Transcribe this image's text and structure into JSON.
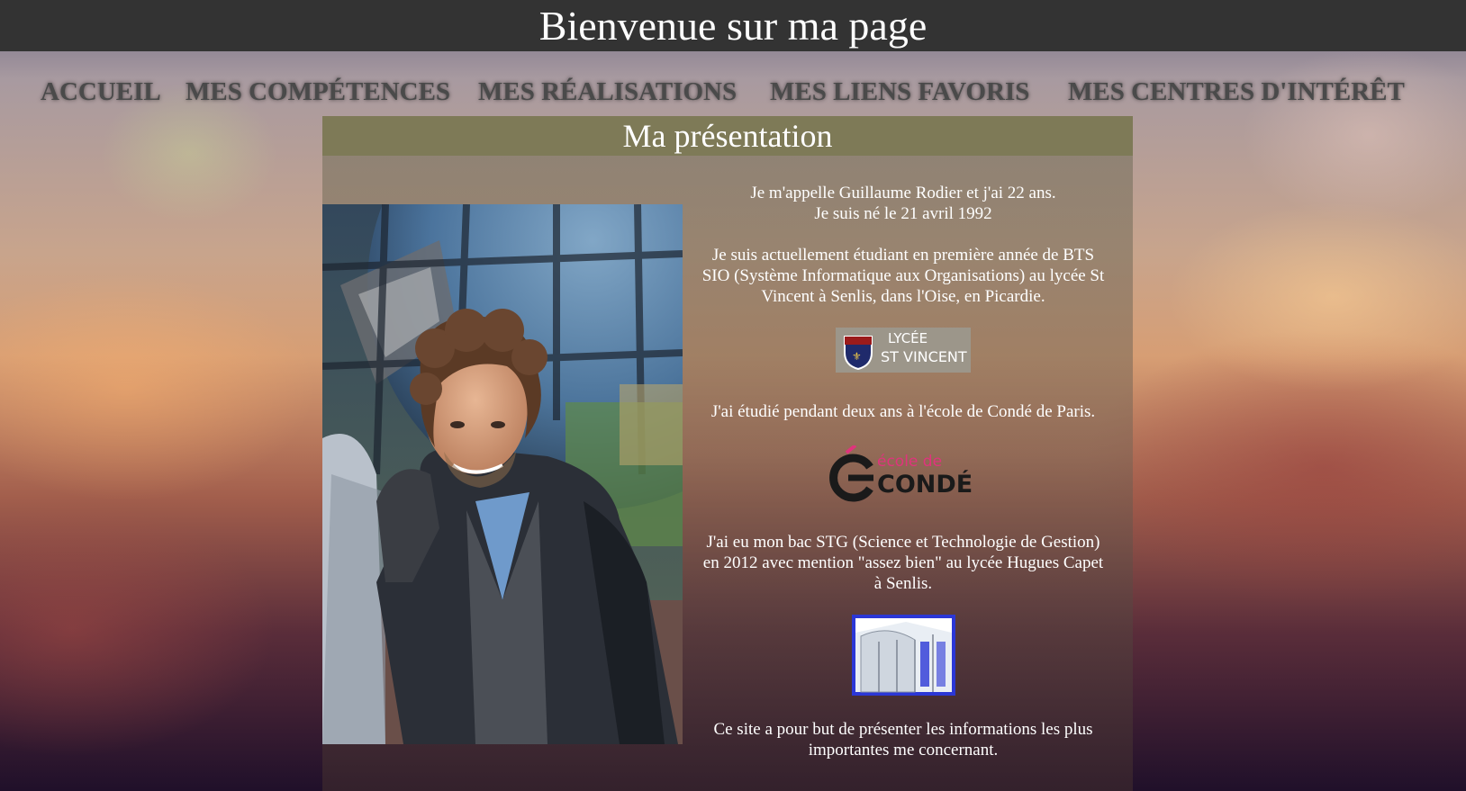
{
  "header": {
    "title": "Bienvenue sur ma page"
  },
  "nav": {
    "items": [
      {
        "label": "ACCUEIL"
      },
      {
        "label": "MES COMPÉTENCES"
      },
      {
        "label": "MES RÉALISATIONS"
      },
      {
        "label": "MES LIENS FAVORIS"
      },
      {
        "label": "MES CENTRES D'INTÉRÊT"
      }
    ]
  },
  "main": {
    "title": "Ma présentation",
    "intro_line1": "Je m'appelle Guillaume Rodier et j'ai 22 ans.",
    "intro_line2": "Je suis né le 21 avril 1992",
    "study_text": "Je suis actuellement étudiant en première année de BTS SIO (Système Informatique aux Organisations) au lycée St Vincent à Senlis, dans l'Oise, en Picardie.",
    "logo_lycee": {
      "line1": "LYCÉE",
      "line2": "ST VINCENT"
    },
    "conde_text": "J'ai étudié pendant deux ans à l'école de Condé de Paris.",
    "logo_conde": {
      "line1": "école de",
      "line2": "CONDÉ"
    },
    "bac_text": "J'ai eu mon bac STG (Science et Technologie de Gestion) en 2012 avec mention \"assez bien\" au lycée Hugues Capet à Senlis.",
    "purpose_text": "Ce site a pour but de présenter les informations les plus importantes me concernant."
  },
  "colors": {
    "topbar": "#333333",
    "panel_title": "#7e7a57",
    "nav_text": "#4a4a4a",
    "conde_accent": "#e0337d"
  }
}
